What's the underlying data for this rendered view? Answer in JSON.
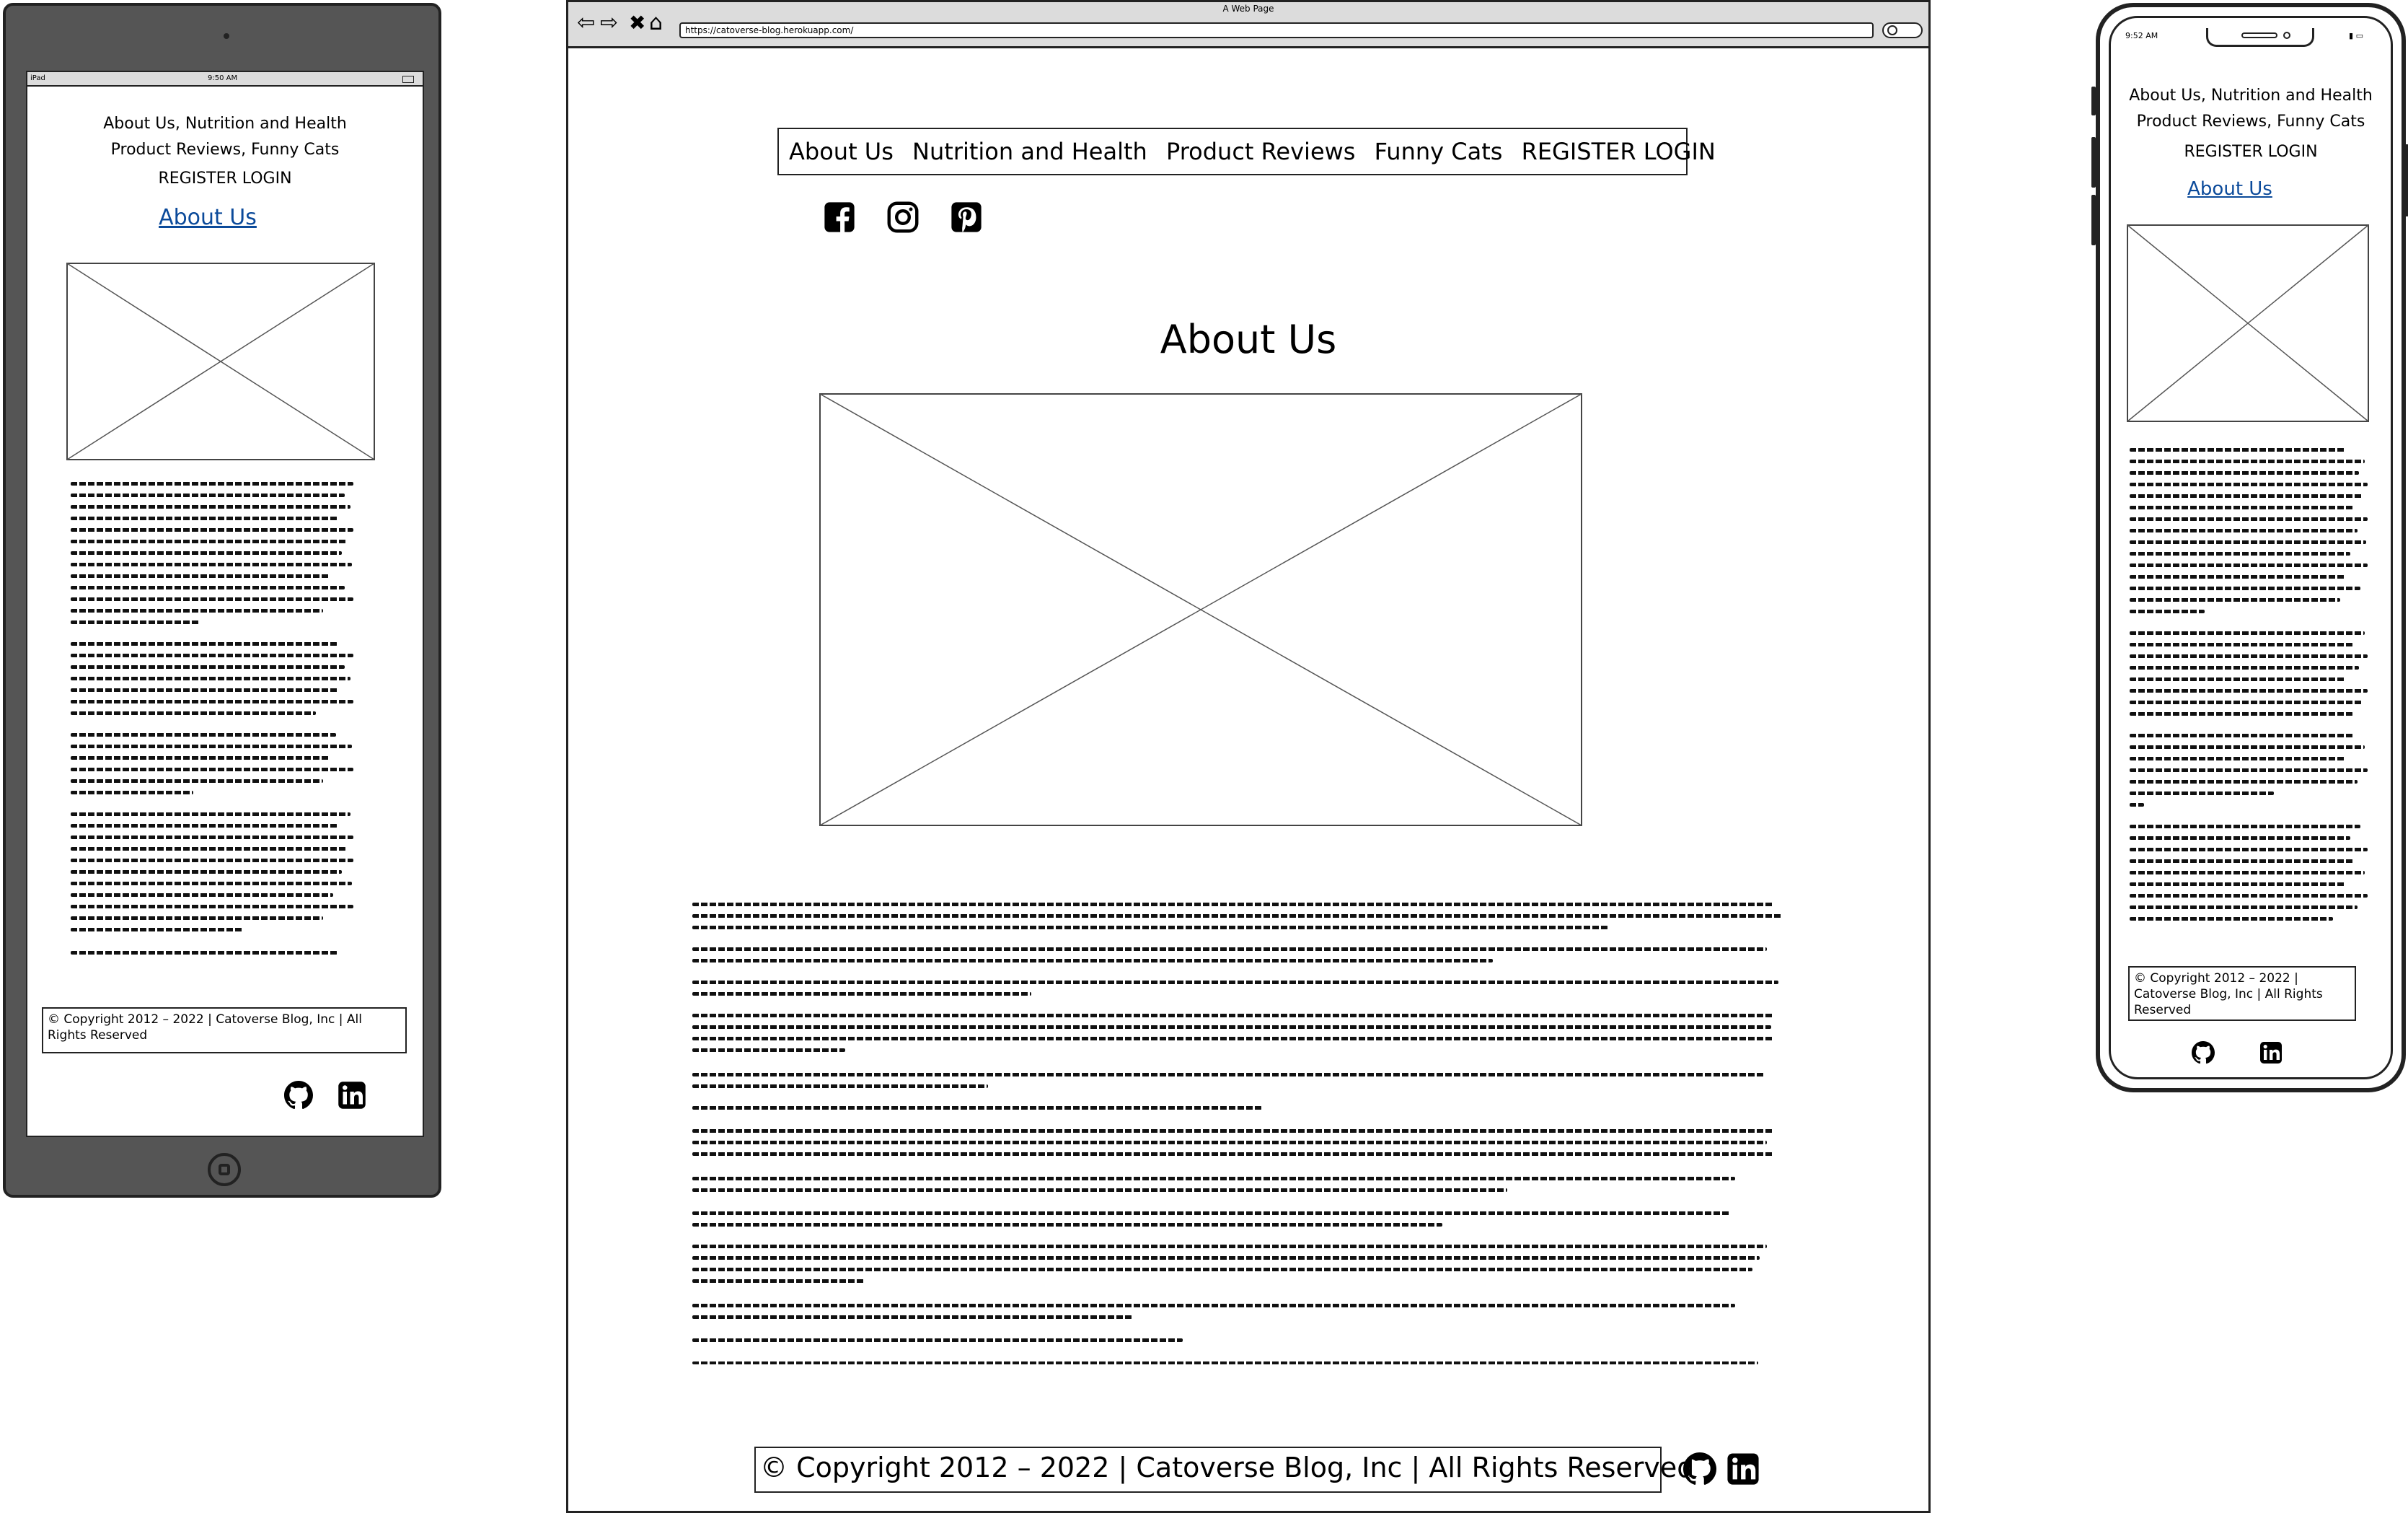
{
  "tablet": {
    "status": {
      "left": "iPad",
      "center": "9:50 AM"
    },
    "nav_line1": "About Us, Nutrition and Health",
    "nav_line2": "Product Reviews, Funny Cats",
    "auth": "REGISTER LOGIN",
    "heading": "About Us",
    "copyright": "© Copyright 2012 – 2022 | Catoverse Blog, Inc | All Rights Reserved",
    "footer_icons": [
      "github-icon",
      "linkedin-icon"
    ]
  },
  "browser": {
    "window_title": "A Web Page",
    "url": "https://catoverse-blog.herokuapp.com/",
    "nav": [
      "About Us",
      "Nutrition and Health",
      "Product Reviews",
      "Funny Cats",
      "REGISTER LOGIN"
    ],
    "social_icons": [
      "facebook-icon",
      "instagram-icon",
      "pinterest-icon"
    ],
    "heading": "About Us",
    "copyright": "© Copyright 2012 – 2022 | Catoverse Blog, Inc | All Rights Reserved",
    "footer_icons": [
      "github-icon",
      "linkedin-icon"
    ]
  },
  "phone": {
    "status_time": "9:52 AM",
    "nav_line1": "About Us, Nutrition and Health",
    "nav_line2": "Product Reviews, Funny Cats",
    "auth": "REGISTER LOGIN",
    "heading": "About Us",
    "copyright": "© Copyright 2012 – 2022 | Catoverse Blog, Inc | All Rights Reserved",
    "footer_icons": [
      "github-icon",
      "linkedin-icon"
    ]
  },
  "colors": {
    "link": "#0b4a9a",
    "frame": "#222222",
    "tablet_body": "#555555",
    "chrome": "#dcdcdc"
  }
}
